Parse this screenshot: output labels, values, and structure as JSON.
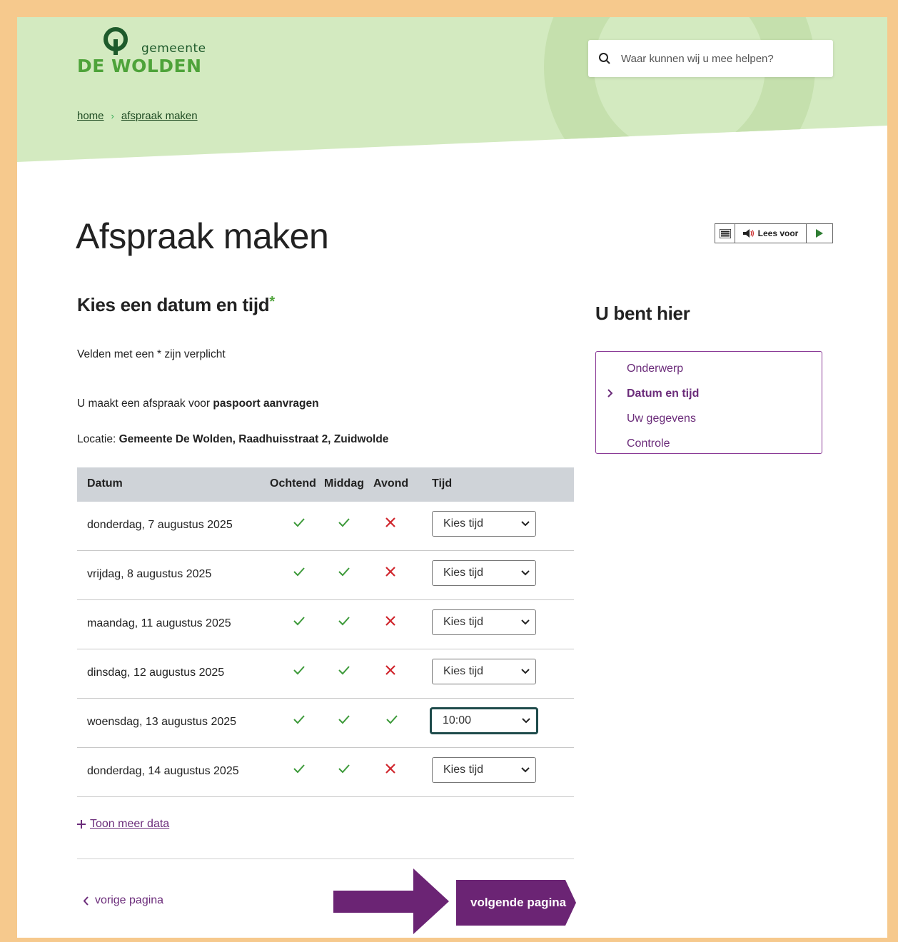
{
  "header": {
    "logo_sub": "gemeente",
    "logo_main": "DE WOLDEN",
    "search_placeholder": "Waar kunnen wij u mee helpen?",
    "breadcrumb": [
      "home",
      "afspraak maken"
    ]
  },
  "page_title": "Afspraak maken",
  "reader": {
    "label": "Lees voor",
    "icons": [
      "menu-icon",
      "speaker-icon",
      "play-icon"
    ]
  },
  "form": {
    "title": "Kies een datum en tijd",
    "required_star": "*",
    "required_note": "Velden met een * zijn verplicht",
    "appointment_prefix": "U maakt een afspraak voor ",
    "appointment_subject": "paspoort aanvragen",
    "location_prefix": "Locatie: ",
    "location_value": "Gemeente De Wolden, Raadhuisstraat 2, Zuidwolde"
  },
  "table": {
    "headers": [
      "Datum",
      "Ochtend",
      "Middag",
      "Avond",
      "Tijd"
    ],
    "rows": [
      {
        "date": "donderdag, 7 augustus 2025",
        "ochtend": true,
        "middag": true,
        "avond": false,
        "tijd": "Kies tijd"
      },
      {
        "date": "vrijdag, 8 augustus 2025",
        "ochtend": true,
        "middag": true,
        "avond": false,
        "tijd": "Kies tijd"
      },
      {
        "date": "maandag, 11 augustus 2025",
        "ochtend": true,
        "middag": true,
        "avond": false,
        "tijd": "Kies tijd"
      },
      {
        "date": "dinsdag, 12 augustus 2025",
        "ochtend": true,
        "middag": true,
        "avond": false,
        "tijd": "Kies tijd"
      },
      {
        "date": "woensdag, 13 augustus 2025",
        "ochtend": true,
        "middag": true,
        "avond": true,
        "tijd": "10:00"
      },
      {
        "date": "donderdag, 14 augustus 2025",
        "ochtend": true,
        "middag": true,
        "avond": false,
        "tijd": "Kies tijd"
      }
    ]
  },
  "more_link": "Toon meer data",
  "nav": {
    "prev": "vorige pagina",
    "next": "volgende pagina"
  },
  "sidebar": {
    "title": "U bent hier",
    "steps": [
      "Onderwerp",
      "Datum en tijd",
      "Uw gegevens",
      "Controle"
    ],
    "current_step": "Datum en tijd"
  },
  "colors": {
    "brand_green": "#4ea33a",
    "header_bg": "#d3eac0",
    "accent_purple": "#6b2474",
    "frame": "#f6c98d"
  }
}
